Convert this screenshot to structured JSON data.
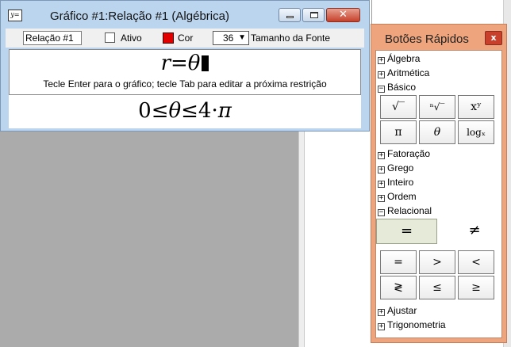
{
  "window": {
    "icon_glyph": "y=",
    "title": "Gráfico #1:Relação #1 (Algébrica)",
    "close_glyph": "✕"
  },
  "toolbar": {
    "relation_name": "Relação #1",
    "active_label": "Ativo",
    "color_label": "Cor",
    "color_value": "#e00000",
    "font_size": "36",
    "font_size_arrow": "▼",
    "font_size_label": "Tamanho da Fonte"
  },
  "editor": {
    "formula": "r=θ",
    "hint": "Tecle Enter para o gráfico; tecle Tab para editar a próxima restrição",
    "restriction_parts": [
      "0≤",
      "θ",
      "≤4·",
      "π"
    ]
  },
  "panel": {
    "title": "Botões Rápidos",
    "close_glyph": "x",
    "nodes": [
      {
        "sign": "+",
        "label": "Álgebra"
      },
      {
        "sign": "+",
        "label": "Aritmética"
      },
      {
        "sign": "−",
        "label": "Básico"
      },
      {
        "sign": "+",
        "label": "Fatoração"
      },
      {
        "sign": "+",
        "label": "Grego"
      },
      {
        "sign": "+",
        "label": "Inteiro"
      },
      {
        "sign": "+",
        "label": "Ordem"
      },
      {
        "sign": "−",
        "label": "Relacional"
      },
      {
        "sign": "+",
        "label": "Ajustar"
      },
      {
        "sign": "+",
        "label": "Trigonometria"
      }
    ],
    "basic_buttons": [
      "√‾",
      "ⁿ√‾",
      "xʸ",
      "π",
      "θ",
      "logₓ"
    ],
    "relational": {
      "big": "=",
      "ne": "≠",
      "buttons": [
        "=",
        ">",
        "<",
        "≷",
        "≤",
        "≥"
      ]
    }
  }
}
